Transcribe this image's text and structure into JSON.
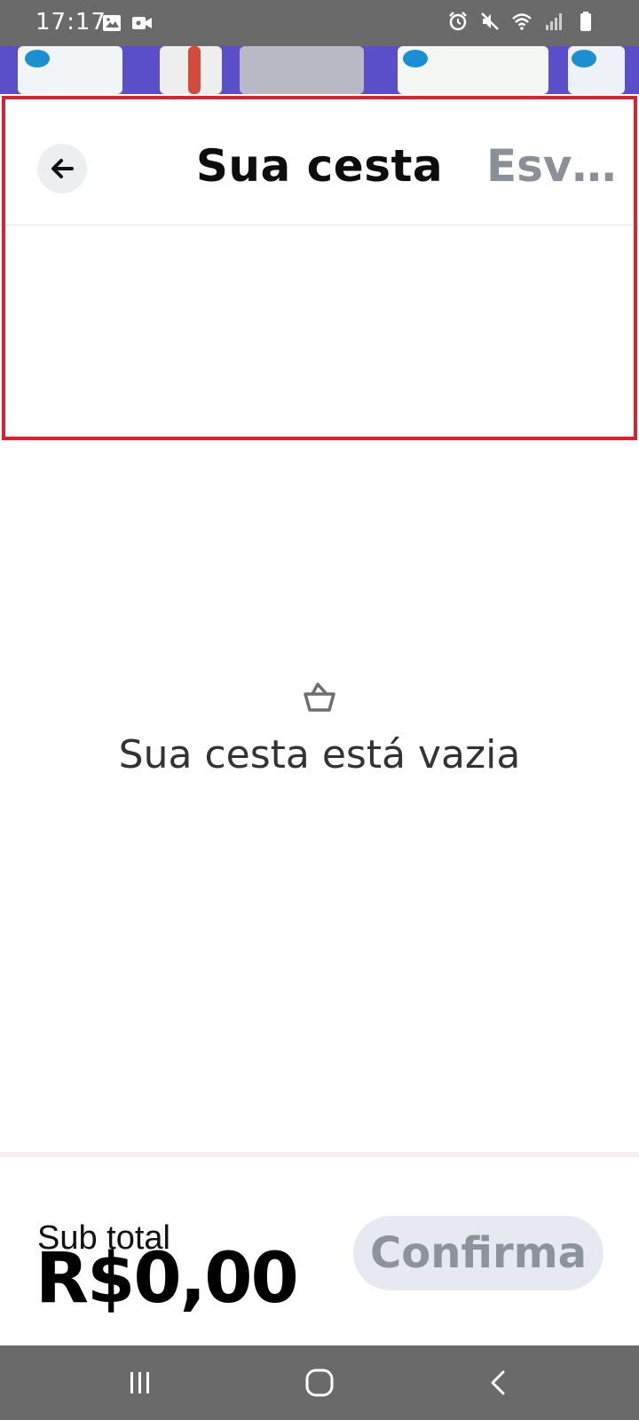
{
  "status_bar": {
    "time": "17:17",
    "left_icons": [
      "gallery-icon",
      "video-camera-icon"
    ],
    "right_icons": [
      "alarm-icon",
      "mute-icon",
      "wifi-icon",
      "signal-icon",
      "battery-icon"
    ]
  },
  "header": {
    "title": "Sua cesta",
    "clear_label": "Esvaziar",
    "back_icon": "arrow-left-icon"
  },
  "empty_state": {
    "icon": "basket-icon",
    "message": "Sua cesta está vazia"
  },
  "footer": {
    "subtotal_label": "Sub total",
    "subtotal_value": "R$0,00",
    "confirm_label": "Confirma"
  },
  "nav_bar": {
    "buttons": [
      "recent-apps-icon",
      "home-icon",
      "back-icon"
    ]
  },
  "colors": {
    "status_bar": "#6a6a6a",
    "title": "#0d0d0d",
    "clear_label": "#8a8f98",
    "confirm_bg": "#e6e9f1",
    "confirm_text": "#8d929c",
    "highlight": "#e0202e"
  }
}
